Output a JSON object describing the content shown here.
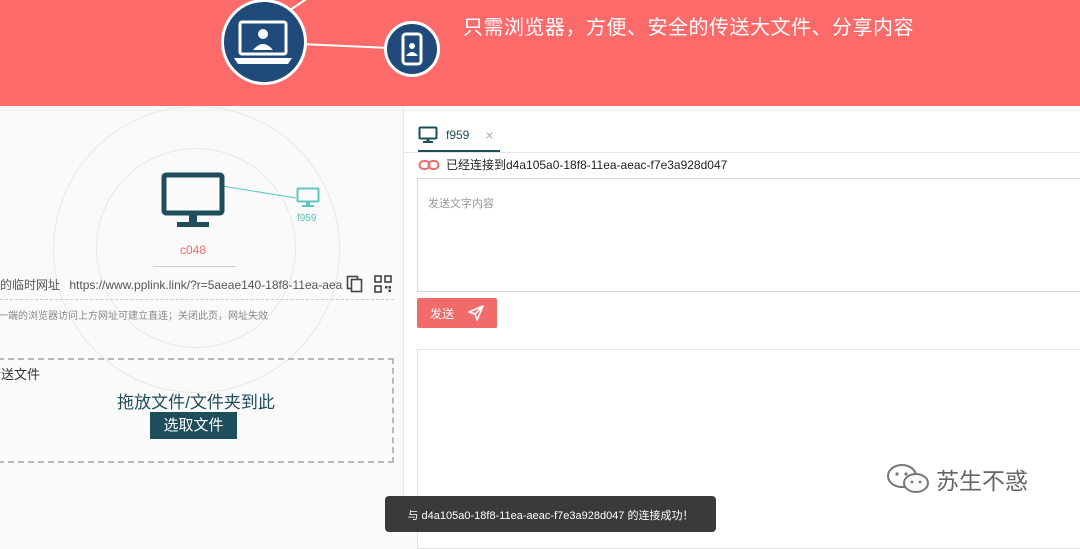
{
  "banner": {
    "slogan": "只需浏览器，方便、安全的传送大文件、分享内容",
    "background_color": "#fd6a6a"
  },
  "host": {
    "name": "c048",
    "icon": "monitor-icon"
  },
  "peer": {
    "name": "f959",
    "icon": "monitor-icon"
  },
  "share": {
    "url_label": "我的临时网址",
    "url_value": "https://www.pplink.link/?r=5aeae140-18f8-11ea-aea",
    "hint": "另一端的浏览器访问上方网址可建立直连；关闭此页，网址失效",
    "copy_icon": "copy-icon",
    "qr_icon": "qrcode-icon"
  },
  "drop": {
    "title": "传送文件",
    "text": "拖放文件/文件夹到此",
    "button": "选取文件"
  },
  "chat": {
    "tab_label": "f959",
    "tab_close": "×",
    "status": "已经连接到d4a105a0-18f8-11ea-aeac-f7e3a928d047",
    "placeholder": "发送文字内容",
    "send_label": "发送"
  },
  "toast": "与 d4a105a0-18f8-11ea-aeac-f7e3a928d047 的连接成功！",
  "watermark": "苏生不惑",
  "colors": {
    "accent": "#f26b6b",
    "dark": "#1e4d5b",
    "peer": "#5cc6c0"
  }
}
